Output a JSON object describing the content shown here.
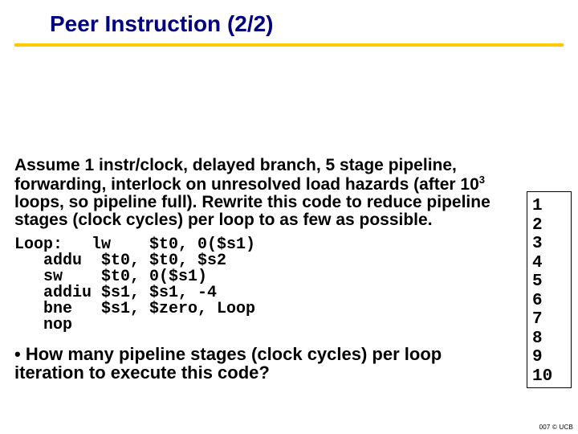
{
  "title": "Peer Instruction (2/2)",
  "paragraph_html": "Assume 1 instr/clock, delayed branch, 5 stage pipeline, forwarding, interlock on unresolved load hazards (after 10<sup>3</sup> loops, so pipeline full). Rewrite this code to reduce pipeline stages (clock cycles) per loop to as few as possible.",
  "code": "Loop:   lw    $t0, 0($s1)\n   addu  $t0, $t0, $s2\n   sw    $t0, 0($s1)\n   addiu $s1, $s1, -4\n   bne   $s1, $zero, Loop\n   nop",
  "question": "• How many pipeline stages (clock cycles) per loop iteration to execute this code?",
  "answers": [
    "1",
    "2",
    "3",
    "4",
    "5",
    "6",
    "7",
    "8",
    "9",
    "10"
  ],
  "footer": "007 © UCB"
}
